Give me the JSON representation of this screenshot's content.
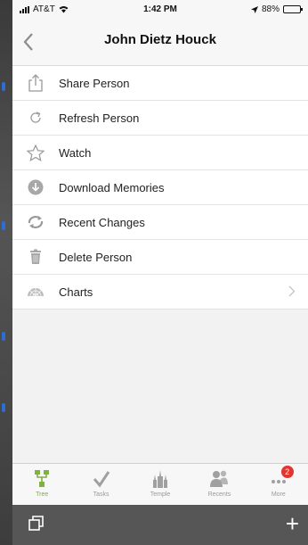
{
  "status": {
    "carrier": "AT&T",
    "time": "1:42 PM",
    "battery": "88%",
    "battery_level": 0.88
  },
  "nav": {
    "title": "John Dietz Houck"
  },
  "menu": [
    {
      "label": "Share Person",
      "icon": "share-icon"
    },
    {
      "label": "Refresh Person",
      "icon": "refresh-icon"
    },
    {
      "label": "Watch",
      "icon": "star-icon"
    },
    {
      "label": "Download Memories",
      "icon": "download-icon"
    },
    {
      "label": "Recent Changes",
      "icon": "recent-changes-icon"
    },
    {
      "label": "Delete Person",
      "icon": "trash-icon"
    },
    {
      "label": "Charts",
      "icon": "fan-chart-icon"
    }
  ],
  "tabs": [
    {
      "label": "Tree",
      "icon": "tree-icon"
    },
    {
      "label": "Tasks",
      "icon": "checkmark-icon"
    },
    {
      "label": "Temple",
      "icon": "temple-icon"
    },
    {
      "label": "Recents",
      "icon": "people-icon"
    },
    {
      "label": "More",
      "icon": "more-icon",
      "badge": "2"
    }
  ],
  "colors": {
    "accent": "#7fb23f",
    "badge": "#e3342f",
    "bottom_bar": "#565656"
  }
}
